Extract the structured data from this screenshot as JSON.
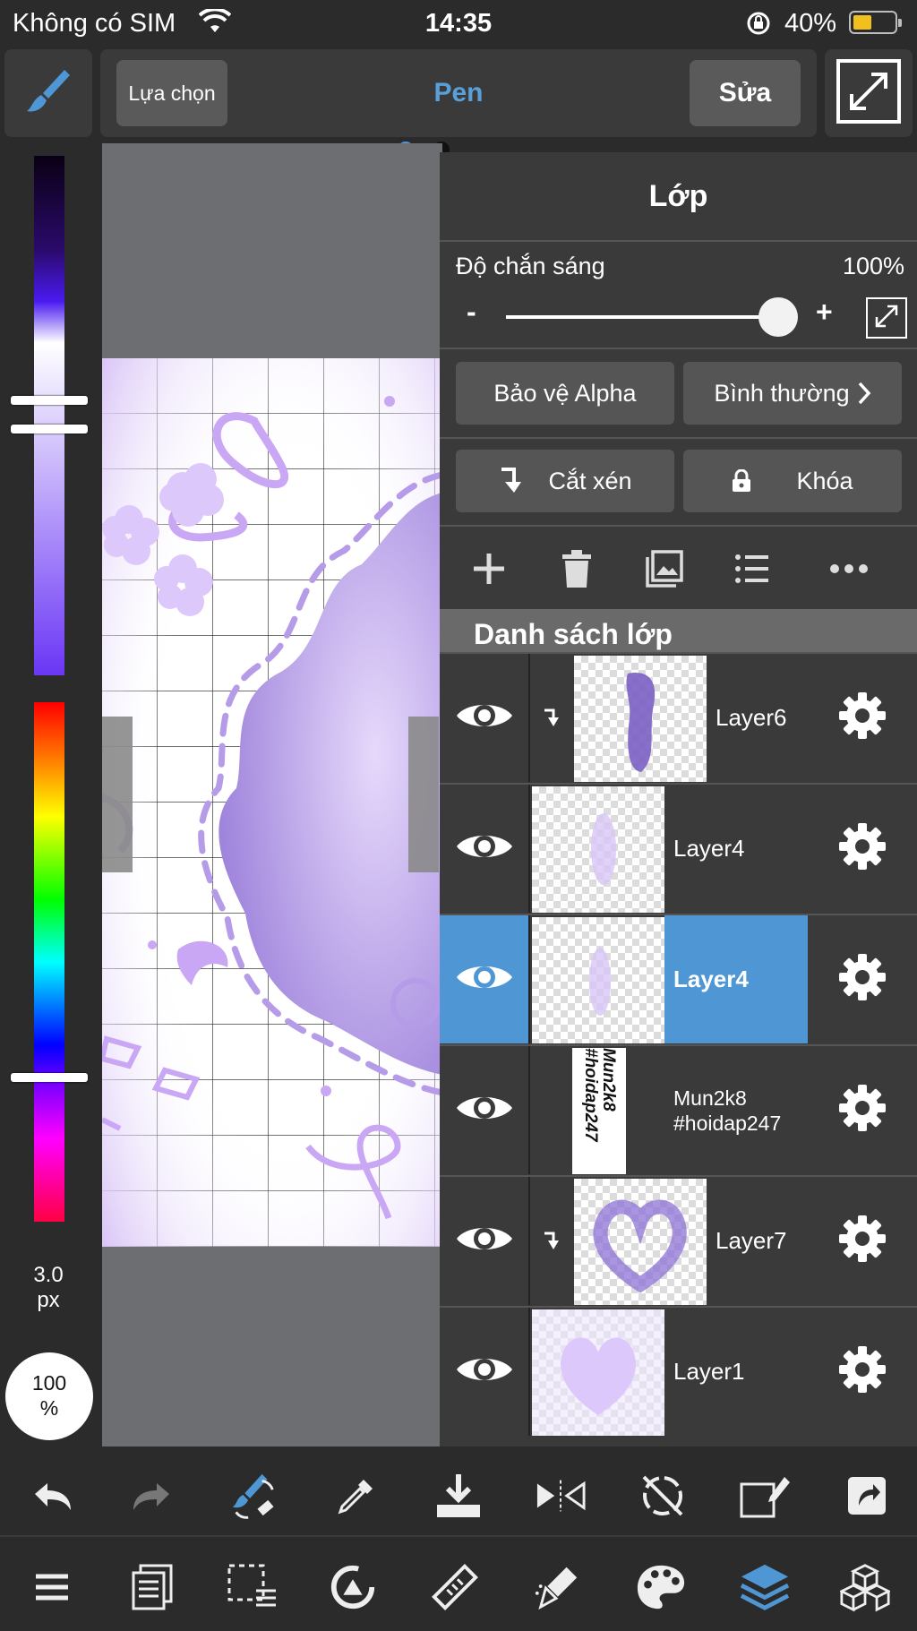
{
  "status_bar": {
    "carrier": "Không có SIM",
    "time": "14:35",
    "battery": "40%"
  },
  "toolbar": {
    "select_label": "Lựa chọn",
    "tool_name": "Pen",
    "edit_label": "Sửa"
  },
  "brush": {
    "size": "3.0",
    "size_unit": "px",
    "opacity": "100",
    "opacity_unit": "%"
  },
  "layer_panel": {
    "title": "Lớp",
    "opacity_label": "Độ chắn sáng",
    "opacity_value": "100%",
    "slider_minus": "-",
    "slider_plus": "+",
    "alpha_protect_label": "Bảo vệ Alpha",
    "blend_mode_label": "Bình thường",
    "clip_label": "Cắt xén",
    "lock_label": "Khóa",
    "list_header": "Danh sách lớp",
    "layers": [
      {
        "name": "Layer6",
        "clipped": true,
        "selected": false
      },
      {
        "name": "Layer4",
        "clipped": false,
        "selected": false
      },
      {
        "name": "Layer4",
        "clipped": false,
        "selected": true
      },
      {
        "name": "Mun2k8\n#hoidap247",
        "clipped": false,
        "selected": false,
        "thumb_text": "Mun2k8\n#hoidap247"
      },
      {
        "name": "Layer7",
        "clipped": true,
        "selected": false
      },
      {
        "name": "Layer1",
        "clipped": false,
        "selected": false
      }
    ]
  },
  "colors": {
    "accent": "#4f97d4",
    "panel_bg": "#3a3a3a",
    "lavender": "#c9a7f5"
  }
}
